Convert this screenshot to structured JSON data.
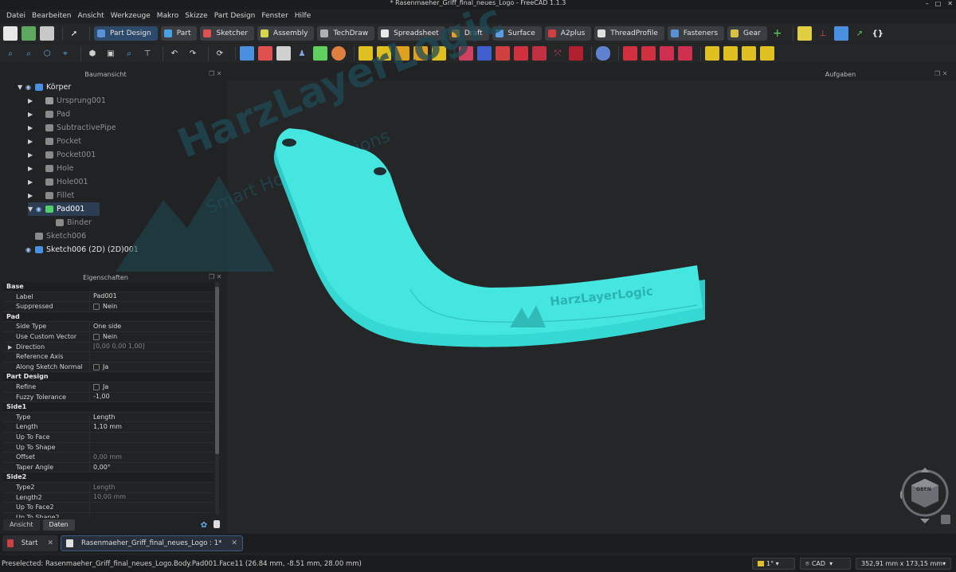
{
  "window": {
    "title": "* Rasenmaeher_Griff_final_neues_Logo - FreeCAD 1.1.3",
    "controls": [
      "–",
      "□",
      "✕"
    ]
  },
  "menubar": [
    "Datei",
    "Bearbeiten",
    "Ansicht",
    "Werkzeuge",
    "Makro",
    "Skizze",
    "Part Design",
    "Fenster",
    "Hilfe"
  ],
  "workbenches": [
    {
      "label": "Part Design",
      "color": "#5b8fd6",
      "active": true
    },
    {
      "label": "Part",
      "color": "#4aa0e0"
    },
    {
      "label": "Sketcher",
      "color": "#e05050"
    },
    {
      "label": "Assembly",
      "color": "#d8d64a"
    },
    {
      "label": "TechDraw",
      "color": "#b0b0b0"
    },
    {
      "label": "Spreadsheet",
      "color": "#e8e8e8"
    },
    {
      "label": "Draft",
      "color": "#e0a030"
    },
    {
      "label": "Surface",
      "color": "#5aa0e0"
    },
    {
      "label": "A2plus",
      "color": "#d04040"
    },
    {
      "label": "ThreadProfile",
      "color": "#e0e0e0"
    },
    {
      "label": "Fasteners",
      "color": "#5a8fd0"
    },
    {
      "label": "Gear",
      "color": "#d8c040"
    }
  ],
  "tree_panel": {
    "title": "Baumansicht",
    "items": [
      {
        "label": "Körper",
        "level": 0,
        "expanded": true,
        "bright": true,
        "icon": "#4a8fe0"
      },
      {
        "label": "Ursprung001",
        "level": 1,
        "icon": "#9a9a9a"
      },
      {
        "label": "Pad",
        "level": 1,
        "icon": "#8a8a8a"
      },
      {
        "label": "SubtractivePipe",
        "level": 1,
        "icon": "#8a8a8a"
      },
      {
        "label": "Pocket",
        "level": 1,
        "icon": "#8a8a8a"
      },
      {
        "label": "Pocket001",
        "level": 1,
        "icon": "#8a8a8a"
      },
      {
        "label": "Hole",
        "level": 1,
        "icon": "#8a8a8a"
      },
      {
        "label": "Hole001",
        "level": 1,
        "icon": "#8a8a8a"
      },
      {
        "label": "Fillet",
        "level": 1,
        "icon": "#8a8a8a"
      },
      {
        "label": "Pad001",
        "level": 1,
        "selected": true,
        "expanded": true,
        "icon": "#4fd06a"
      },
      {
        "label": "Binder",
        "level": 2,
        "icon": "#8a8a8a"
      },
      {
        "label": "Sketch006",
        "level": 0,
        "icon": "#8a8a8a"
      },
      {
        "label": "Sketch006 (2D) (2D)001",
        "level": 0,
        "bright": true,
        "icon": "#4a8fe0"
      }
    ]
  },
  "tasks_panel": {
    "title": "Aufgaben"
  },
  "properties": {
    "title": "Eigenschaften",
    "rows": [
      {
        "group": "Base"
      },
      {
        "name": "Label",
        "value": "Pad001"
      },
      {
        "name": "Suppressed",
        "value": "Nein",
        "check": true
      },
      {
        "group": "Pad"
      },
      {
        "name": "Side Type",
        "value": "One side"
      },
      {
        "name": "Use Custom Vector",
        "value": "Nein",
        "check": true
      },
      {
        "name": "Direction",
        "value": "[0,00 0,00 1,00]",
        "dim": true,
        "expand": true
      },
      {
        "name": "Reference Axis",
        "value": ""
      },
      {
        "name": "Along Sketch Normal",
        "value": "Ja",
        "check": true
      },
      {
        "group": "Part Design"
      },
      {
        "name": "Refine",
        "value": "Ja",
        "check": true
      },
      {
        "name": "Fuzzy Tolerance",
        "value": "-1,00"
      },
      {
        "group": "Side1"
      },
      {
        "name": "Type",
        "value": "Length"
      },
      {
        "name": "Length",
        "value": "1,10 mm"
      },
      {
        "name": "Up To Face",
        "value": ""
      },
      {
        "name": "Up To Shape",
        "value": ""
      },
      {
        "name": "Offset",
        "value": "0,00 mm",
        "dim": true
      },
      {
        "name": "Taper Angle",
        "value": "0,00°"
      },
      {
        "group": "Side2"
      },
      {
        "name": "Type2",
        "value": "Length",
        "dim": true
      },
      {
        "name": "Length2",
        "value": "10,00 mm",
        "dim": true
      },
      {
        "name": "Up To Face2",
        "value": ""
      },
      {
        "name": "Up To Shape2",
        "value": ""
      }
    ],
    "tabs": [
      "Ansicht",
      "Daten"
    ]
  },
  "doc_tabs": [
    {
      "label": "Start",
      "icon": "#d04040"
    },
    {
      "label": "Rasenmaeher_Griff_final_neues_Logo : 1*",
      "icon": "#e0e0e0",
      "active": true
    }
  ],
  "status": {
    "text": "Preselected: Rasenmaeher_Griff_final_neues_Logo.Body.Pad001.Face11 (26.84 mm, -8.51 mm, 28.00 mm)",
    "nav_style": "CAD",
    "dimensions": "352,91 mm x 173,15 mm",
    "units": "1°"
  },
  "viewport": {
    "watermark_brand": "HarzLayerLogic",
    "watermark_tagline": "Smart Home Solutions",
    "part_logo": "HarzLayerLogic",
    "navcube_face": "OBEN",
    "part_color": "#46e6e0"
  }
}
